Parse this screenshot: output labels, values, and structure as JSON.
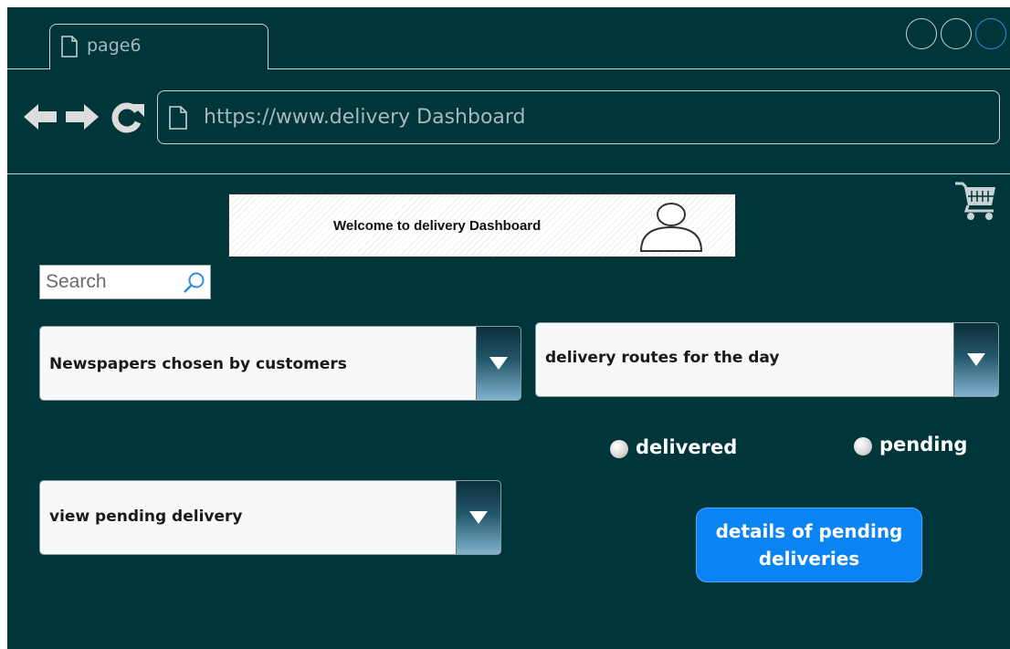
{
  "browser": {
    "tab_label": "page6",
    "url": "https://www.delivery Dashboard"
  },
  "header": {
    "welcome_text": "Welcome to delivery Dashboard"
  },
  "search": {
    "placeholder": "Search"
  },
  "dropdowns": {
    "newspapers": "Newspapers chosen by customers",
    "routes": "delivery routes for the day",
    "pending": "view pending delivery"
  },
  "status": {
    "delivered_label": "delivered",
    "pending_label": "pending"
  },
  "actions": {
    "details_line1": "details of pending",
    "details_line2": "deliveries"
  },
  "colors": {
    "background": "#00363a",
    "accent": "#0a84f2",
    "window_active": "#2d8fe8"
  },
  "icons": [
    "page-icon",
    "back-arrow-icon",
    "forward-arrow-icon",
    "reload-icon",
    "cart-icon",
    "user-icon",
    "search-icon",
    "chevron-down-icon"
  ]
}
